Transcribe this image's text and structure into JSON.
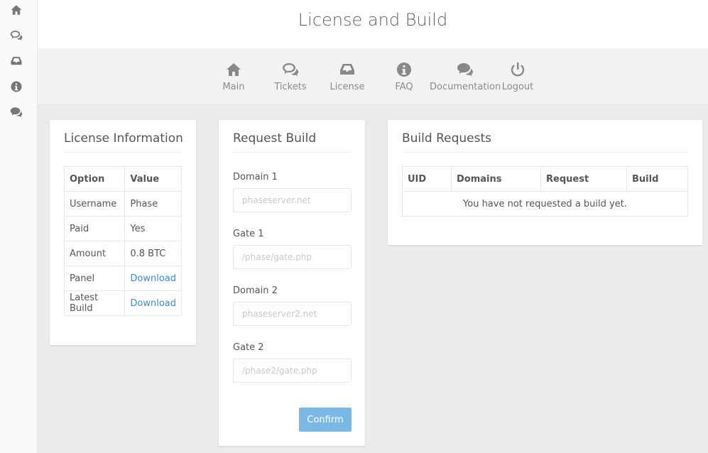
{
  "page": {
    "title": "License and Build"
  },
  "sidebar": {
    "icons": [
      "home-icon",
      "comments-outline-icon",
      "inbox-icon",
      "info-circle-icon",
      "comments-icon"
    ]
  },
  "nav": {
    "items": [
      {
        "label": "Main",
        "icon": "home-icon"
      },
      {
        "label": "Tickets",
        "icon": "comments-outline-icon"
      },
      {
        "label": "License",
        "icon": "inbox-icon"
      },
      {
        "label": "FAQ",
        "icon": "info-circle-icon"
      },
      {
        "label": "Documentation",
        "icon": "comments-icon"
      },
      {
        "label": "Logout",
        "icon": "power-icon"
      }
    ]
  },
  "license": {
    "title": "License Information",
    "headers": [
      "Option",
      "Value"
    ],
    "rows": [
      {
        "option": "Username",
        "value": "Phase"
      },
      {
        "option": "Paid",
        "value": "Yes"
      },
      {
        "option": "Amount",
        "value": "0.8 BTC"
      },
      {
        "option": "Panel",
        "value": "Download"
      },
      {
        "option": "Latest Build",
        "value": "Download"
      }
    ]
  },
  "request": {
    "title": "Request Build",
    "fields": [
      {
        "label": "Domain 1",
        "placeholder": "phaseserver.net"
      },
      {
        "label": "Gate 1",
        "placeholder": "/phase/gate.php"
      },
      {
        "label": "Domain 2",
        "placeholder": "phaseserver2.net"
      },
      {
        "label": "Gate 2",
        "placeholder": "/phase2/gate.php"
      }
    ],
    "confirm_label": "Confirm"
  },
  "builds": {
    "title": "Build Requests",
    "headers": [
      "UID",
      "Domains",
      "Request",
      "Build"
    ],
    "empty_message": "You have not requested a build yet."
  },
  "colors": {
    "accent": "#7cb8e6",
    "link": "#3a8fc8"
  }
}
